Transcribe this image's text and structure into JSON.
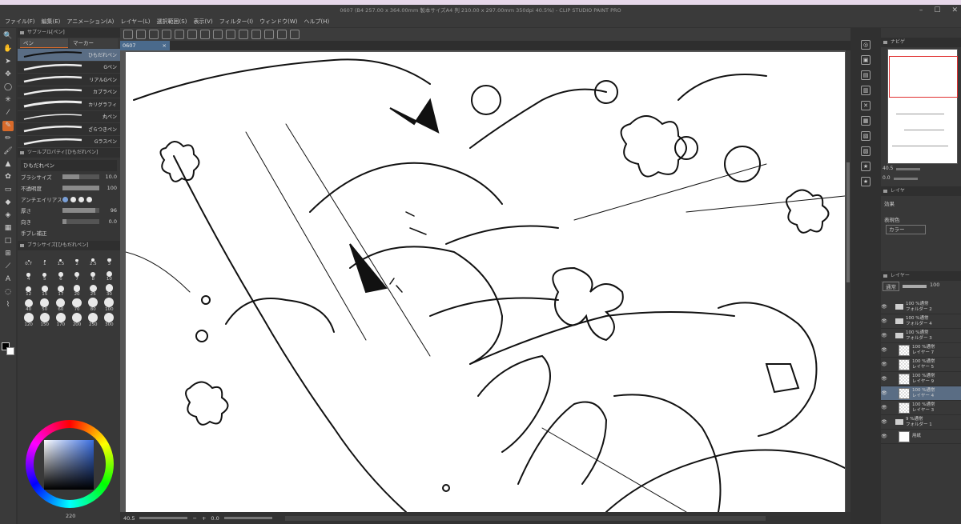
{
  "window": {
    "title": "0607 (B4 257.00 x 364.00mm 製本サイズA4 判 210.00 x 297.00mm 350dpi 40.5%) - CLIP STUDIO PAINT PRO"
  },
  "menu": [
    "ファイル(F)",
    "編集(E)",
    "アニメーション(A)",
    "レイヤー(L)",
    "選択範囲(S)",
    "表示(V)",
    "フィルター(I)",
    "ウィンドウ(W)",
    "ヘルプ(H)"
  ],
  "canvas_tab": {
    "label": "0607",
    "close": "×"
  },
  "left": {
    "subtool_header": "サブツール[ペン]",
    "subtabs": [
      "ペン",
      "マーカー"
    ],
    "brushes": [
      "ひもだれペン",
      "Gペン",
      "リアルGペン",
      "カブラペン",
      "カリグラフィ",
      "丸ペン",
      "ざらつきペン",
      "Gラスペン"
    ],
    "props_header": "ツールプロパティ[ひもだれペン]",
    "props_name": "ひもだれペン",
    "props": [
      {
        "label": "ブラシサイズ",
        "value": "10.0",
        "level": 0.45
      },
      {
        "label": "不透明度",
        "value": "100",
        "level": 1.0
      },
      {
        "label": "アンチエイリアス",
        "value": "",
        "level": 0
      },
      {
        "label": "厚さ",
        "value": "96",
        "level": 0.9
      },
      {
        "label": "向き",
        "value": "0.0",
        "level": 0.1
      },
      {
        "label": "手ブレ補正",
        "value": "",
        "level": 0
      }
    ],
    "size_header": "ブラシサイズ[ひもだれペン]",
    "sizes": [
      "0.7",
      "1",
      "1.5",
      "2",
      "2.5",
      "3",
      "4",
      "5",
      "6",
      "7",
      "8",
      "10",
      "12",
      "15",
      "17",
      "20",
      "25",
      "30",
      "40",
      "50",
      "60",
      "70",
      "80",
      "100",
      "120",
      "150",
      "170",
      "200",
      "250",
      "300"
    ],
    "color_value": "220"
  },
  "status": {
    "zoom": "40.5",
    "angle": "0.0"
  },
  "right": {
    "nav_label": "ナビゲ",
    "nav_zoom": "40.5",
    "nav_angle": "0.0",
    "layer_tab_label": "レイヤ",
    "effect_label": "効果",
    "expr_label": "表現色",
    "expr_value": "カラー",
    "layer_panel_label": "レイヤー",
    "blend": "通常",
    "opacity": "100",
    "layers": [
      {
        "op": "100 %通常",
        "name": "フォルダー 2",
        "type": "folder"
      },
      {
        "op": "100 %通常",
        "name": "フォルダー 4",
        "type": "folder"
      },
      {
        "op": "100 %通常",
        "name": "フォルダー 3",
        "type": "folder"
      },
      {
        "op": "100 %通常",
        "name": "レイヤー 7",
        "type": "layer"
      },
      {
        "op": "100 %通常",
        "name": "レイヤー 5",
        "type": "layer"
      },
      {
        "op": "100 %通常",
        "name": "レイヤー 9",
        "type": "layer"
      },
      {
        "op": "100 %通常",
        "name": "レイヤー 4",
        "type": "layer",
        "selected": true
      },
      {
        "op": "100 %通常",
        "name": "レイヤー 3",
        "type": "layer"
      },
      {
        "op": "9 %通常",
        "name": "フォルダー 1",
        "type": "folder"
      },
      {
        "op": "",
        "name": "用紙",
        "type": "paper"
      }
    ]
  },
  "colors": {
    "accent": "#d86a2a",
    "selection": "#5a6d84",
    "panel": "#383838"
  }
}
